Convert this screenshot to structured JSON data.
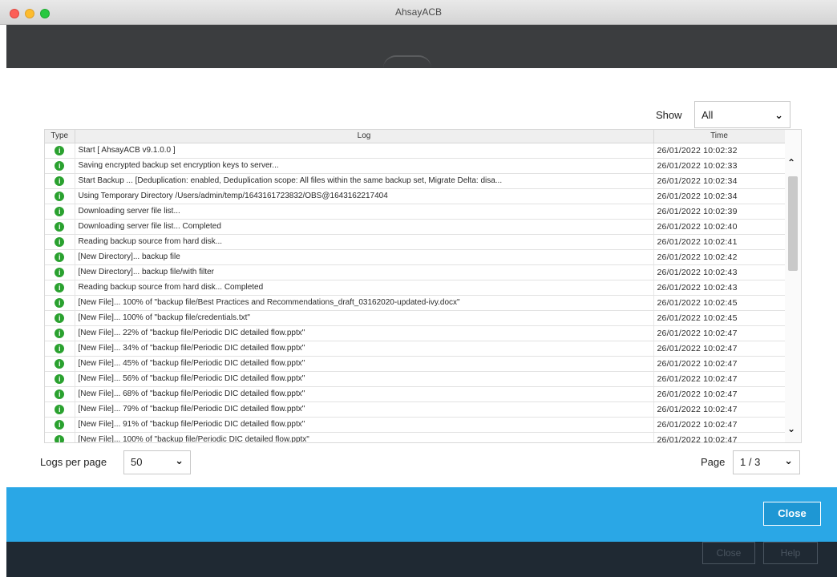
{
  "window": {
    "title": "AhsayACB"
  },
  "filter": {
    "show_label": "Show",
    "show_value": "All"
  },
  "table": {
    "headers": {
      "type": "Type",
      "log": "Log",
      "time": "Time"
    },
    "rows": [
      {
        "log": "Start [ AhsayACB v9.1.0.0 ]",
        "time": "26/01/2022 10:02:32"
      },
      {
        "log": "Saving encrypted backup set encryption keys to server...",
        "time": "26/01/2022 10:02:33"
      },
      {
        "log": "Start Backup ... [Deduplication: enabled, Deduplication scope: All files within the same backup set, Migrate Delta: disa...",
        "time": "26/01/2022 10:02:34"
      },
      {
        "log": "Using Temporary Directory /Users/admin/temp/1643161723832/OBS@1643162217404",
        "time": "26/01/2022 10:02:34"
      },
      {
        "log": "Downloading server file list...",
        "time": "26/01/2022 10:02:39"
      },
      {
        "log": "Downloading server file list... Completed",
        "time": "26/01/2022 10:02:40"
      },
      {
        "log": "Reading backup source from hard disk...",
        "time": "26/01/2022 10:02:41"
      },
      {
        "log": "[New Directory]... backup file",
        "time": "26/01/2022 10:02:42"
      },
      {
        "log": "[New Directory]... backup file/with filter",
        "time": "26/01/2022 10:02:43"
      },
      {
        "log": "Reading backup source from hard disk... Completed",
        "time": "26/01/2022 10:02:43"
      },
      {
        "log": "[New File]... 100% of \"backup file/Best Practices and Recommendations_draft_03162020-updated-ivy.docx\"",
        "time": "26/01/2022 10:02:45"
      },
      {
        "log": "[New File]... 100% of \"backup file/credentials.txt\"",
        "time": "26/01/2022 10:02:45"
      },
      {
        "log": "[New File]... 22% of \"backup file/Periodic DIC detailed flow.pptx\"",
        "time": "26/01/2022 10:02:47"
      },
      {
        "log": "[New File]... 34% of \"backup file/Periodic DIC detailed flow.pptx\"",
        "time": "26/01/2022 10:02:47"
      },
      {
        "log": "[New File]... 45% of \"backup file/Periodic DIC detailed flow.pptx\"",
        "time": "26/01/2022 10:02:47"
      },
      {
        "log": "[New File]... 56% of \"backup file/Periodic DIC detailed flow.pptx\"",
        "time": "26/01/2022 10:02:47"
      },
      {
        "log": "[New File]... 68% of \"backup file/Periodic DIC detailed flow.pptx\"",
        "time": "26/01/2022 10:02:47"
      },
      {
        "log": "[New File]... 79% of \"backup file/Periodic DIC detailed flow.pptx\"",
        "time": "26/01/2022 10:02:47"
      },
      {
        "log": "[New File]... 91% of \"backup file/Periodic DIC detailed flow.pptx\"",
        "time": "26/01/2022 10:02:47"
      },
      {
        "log": "[New File]... 100% of \"backup file/Periodic DIC detailed flow.pptx\"",
        "time": "26/01/2022 10:02:47"
      }
    ],
    "row_icon": "info-icon",
    "row_icon_color": "#2aa12f"
  },
  "pagination": {
    "logs_per_page_label": "Logs per page",
    "logs_per_page_value": "50",
    "page_label": "Page",
    "page_value": "1 / 3"
  },
  "footer": {
    "close_label": "Close",
    "accent_color": "#2aa7e6"
  },
  "background_buttons": {
    "close_label": "Close",
    "help_label": "Help"
  }
}
